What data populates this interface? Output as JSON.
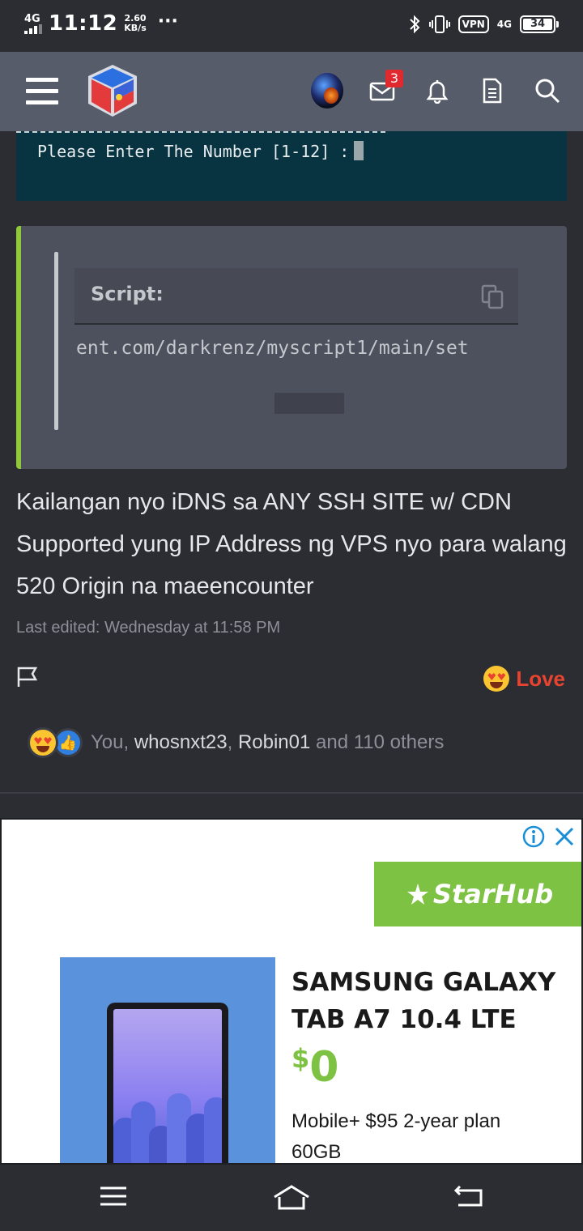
{
  "status_bar": {
    "network": "4G",
    "time": "11:12",
    "speed_value": "2.60",
    "speed_unit": "KB/s",
    "more": "···",
    "vpn": "VPN",
    "net2": "4G",
    "battery": "34"
  },
  "navbar": {
    "message_badge": "3",
    "icons": [
      "menu-icon",
      "site-logo",
      "user-avatar",
      "inbox-icon",
      "bell-icon",
      "document-icon",
      "search-icon"
    ]
  },
  "terminal": {
    "prompt": "Please Enter The Number [1-12] :"
  },
  "code_block": {
    "label": "Script:",
    "code": "ent.com/darkrenz/myscript1/main/set"
  },
  "post": {
    "text": "Kailangan nyo iDNS sa ANY SSH SITE w/ CDN Supported yung IP Address ng VPS nyo para walang 520 Origin na maeencounter",
    "last_edited": "Last edited: Wednesday at 11:58 PM",
    "reaction_label": "Love",
    "reactions": {
      "you": "You,",
      "user1": "whosnxt23",
      "comma": ",",
      "user2": "Robin01",
      "others": "and 110 others"
    }
  },
  "ad": {
    "brand": "StarHub",
    "title_line1": "SAMSUNG GALAXY",
    "title_line2": "TAB A7 10.4 LTE",
    "price_currency": "$",
    "price_value": "0",
    "plan_line1": "Mobile+ $95 2-year plan",
    "plan_line2": "60GB"
  },
  "colors": {
    "accent_green": "#8fc93a",
    "love_red": "#e8432f",
    "starhub_green": "#7dc243",
    "navbar_bg": "#565c69"
  }
}
